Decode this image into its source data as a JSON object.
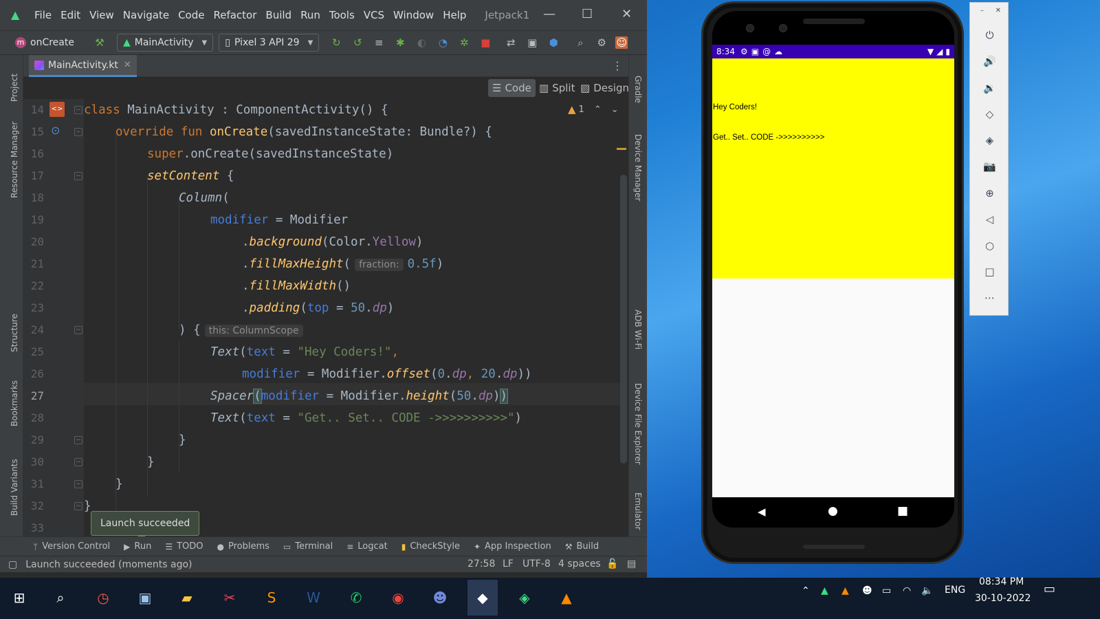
{
  "menu": {
    "items": [
      "File",
      "Edit",
      "View",
      "Navigate",
      "Code",
      "Refactor",
      "Build",
      "Run",
      "Tools",
      "VCS",
      "Window",
      "Help"
    ],
    "project_title": "Jetpack1"
  },
  "toolbar": {
    "breadcrumb_badge": "m",
    "breadcrumb": "onCreate",
    "config": "MainActivity",
    "device": "Pixel 3 API 29"
  },
  "left_tabs": [
    "Project",
    "Resource Manager",
    "Structure",
    "Bookmarks",
    "Build Variants"
  ],
  "right_tabs": [
    "Gradle",
    "Device Manager",
    "ADB Wi-Fi",
    "Device File Explorer",
    "Emulator"
  ],
  "editor": {
    "tab": "MainActivity.kt",
    "views": [
      "Code",
      "Split",
      "Design"
    ],
    "warnings": "1",
    "line_numbers": [
      "14",
      "15",
      "16",
      "17",
      "18",
      "19",
      "20",
      "21",
      "22",
      "23",
      "24",
      "25",
      "26",
      "27",
      "28",
      "29",
      "30",
      "31",
      "32",
      "33"
    ],
    "hint_fraction": "fraction:",
    "hint_scope": "this: ColumnScope",
    "code": {
      "l14": [
        "class",
        " MainActivity : ComponentActivity() {"
      ],
      "l15": [
        "override fun ",
        "onCreate",
        "(savedInstanceState: Bundle?) {"
      ],
      "l16": [
        "super",
        ".onCreate(savedInstanceState)"
      ],
      "l17": [
        "setContent",
        " {"
      ],
      "l18": [
        "Column",
        "("
      ],
      "l19": [
        "modifier",
        " = Modifier"
      ],
      "l20": [
        ".",
        "background",
        "(Color.",
        "Yellow",
        ")"
      ],
      "l21": [
        ".",
        "fillMaxHeight",
        "(",
        "0.5f",
        ")"
      ],
      "l22": [
        ".",
        "fillMaxWidth",
        "()"
      ],
      "l23": [
        ".",
        "padding",
        "(",
        "top",
        " = ",
        "50",
        ".",
        "dp",
        ")"
      ],
      "l24": [
        ") {"
      ],
      "l25": [
        "Text",
        "(",
        "text",
        " = ",
        "\"Hey Coders!\"",
        ","
      ],
      "l26": [
        "modifier",
        " = Modifier.",
        "offset",
        "(",
        "0",
        ".",
        "dp",
        ", ",
        "20",
        ".",
        "dp",
        "))"
      ],
      "l27": [
        "Spacer",
        "(",
        "modifier",
        " = Modifier.",
        "height",
        "(",
        "50",
        ".",
        "dp",
        ")",
        ")"
      ],
      "l28": [
        "Text",
        "(",
        "text",
        " = ",
        "\"Get.. Set.. CODE ->>>>>>>>>>\"",
        ")"
      ],
      "l29": [
        "}"
      ],
      "l30": [
        "}"
      ],
      "l31": [
        "}"
      ],
      "l32": [
        "}"
      ]
    }
  },
  "toast": "Launch succeeded",
  "bottom_tabs": [
    "Version Control",
    "Run",
    "TODO",
    "Problems",
    "Terminal",
    "Logcat",
    "CheckStyle",
    "App Inspection",
    "Build"
  ],
  "status": {
    "message": "Launch succeeded (moments ago)",
    "position": "27:58",
    "line_sep": "LF",
    "encoding": "UTF-8",
    "indent": "4 spaces"
  },
  "emulator": {
    "time": "8:34",
    "text1": "Hey Coders!",
    "text2": "Get.. Set.. CODE ->>>>>>>>>>"
  },
  "taskbar": {
    "language": "ENG",
    "time": "08:34 PM",
    "date": "30-10-2022"
  },
  "colors": {
    "ide_bg": "#2b2b2b",
    "keyword": "#cc7832",
    "function": "#ffc66d",
    "string": "#6a8759",
    "number": "#6897bb",
    "property": "#9876aa",
    "app_status_bar": "#3700b3",
    "app_yellow": "#ffff00"
  }
}
